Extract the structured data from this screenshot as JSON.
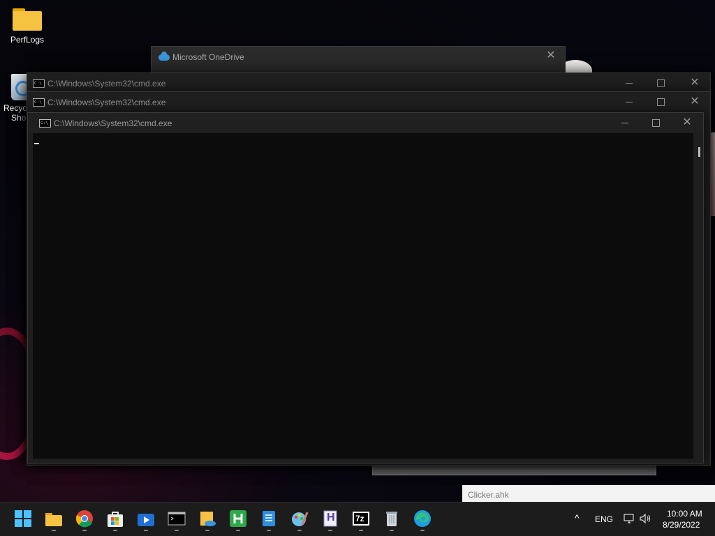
{
  "desktop": {
    "icons": [
      {
        "label": "PerfLogs",
        "icon": "folder-icon"
      },
      {
        "label": "Recycl Shor",
        "line1": "Recycl",
        "line2": "Shor",
        "icon": "recycle-bin-icon"
      }
    ]
  },
  "onedrive": {
    "title": "Microsoft OneDrive",
    "close": "✕"
  },
  "cmd_windows": [
    {
      "title": "C:\\Windows\\System32\\cmd.exe"
    },
    {
      "title": "C:\\Windows\\System32\\cmd.exe"
    },
    {
      "title": "C:\\Windows\\System32\\cmd.exe"
    }
  ],
  "controls": {
    "close": "✕"
  },
  "cmd_icon_text": "C:\\",
  "clicker": {
    "label": "Clicker.ahk"
  },
  "taskbar": {
    "apps": [
      "start-icon",
      "file-explorer-icon",
      "chrome-icon",
      "store-icon",
      "media-player-icon",
      "terminal-icon",
      "onedrive-folder-icon",
      "h-app-icon",
      "notepad-icon",
      "paint-icon",
      "hex-editor-icon",
      "7zip-icon",
      "recycle-app-icon",
      "edge-icon"
    ],
    "hex_letter": "H",
    "zip_text": "7z",
    "tray": {
      "chevron": "^",
      "language": "ENG",
      "time": "10:00 AM",
      "date": "8/29/2022"
    }
  },
  "colors": {
    "accent": "#0078d4",
    "console_bg": "#0c0c0c",
    "titlebar": "#202020"
  }
}
